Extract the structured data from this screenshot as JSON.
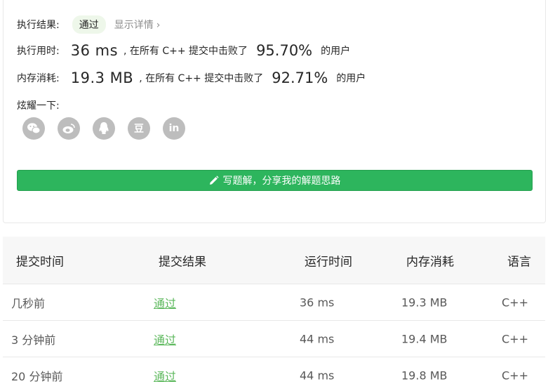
{
  "result": {
    "label": "执行结果:",
    "status": "通过",
    "detail_link": "显示详情",
    "chevron": "›"
  },
  "runtime": {
    "label": "执行用时:",
    "value": "36 ms",
    "text": ", 在所有 C++ 提交中击败了",
    "percent": "95.70%",
    "suffix": "的用户"
  },
  "memory": {
    "label": "内存消耗:",
    "value": "19.3 MB",
    "text": ", 在所有 C++ 提交中击败了",
    "percent": "92.71%",
    "suffix": "的用户"
  },
  "share": {
    "label": "炫耀一下:",
    "icons": [
      "wechat-icon",
      "weibo-icon",
      "qq-icon",
      "douban-icon",
      "linkedin-icon"
    ],
    "douban_glyph": "豆",
    "linkedin_glyph": "in"
  },
  "solution_button": {
    "label": "写题解，分享我的解题思路",
    "icon": "pencil-icon",
    "color": "#2db55d"
  },
  "table": {
    "headers": [
      "提交时间",
      "提交结果",
      "运行时间",
      "内存消耗",
      "语言"
    ],
    "rows": [
      {
        "time": "几秒前",
        "result": "通过",
        "runtime": "36 ms",
        "memory": "19.3 MB",
        "lang": "C++"
      },
      {
        "time": "3 分钟前",
        "result": "通过",
        "runtime": "44 ms",
        "memory": "19.4 MB",
        "lang": "C++"
      },
      {
        "time": "20 分钟前",
        "result": "通过",
        "runtime": "44 ms",
        "memory": "19.8 MB",
        "lang": "C++"
      }
    ],
    "status_color": "#5cb85c"
  }
}
